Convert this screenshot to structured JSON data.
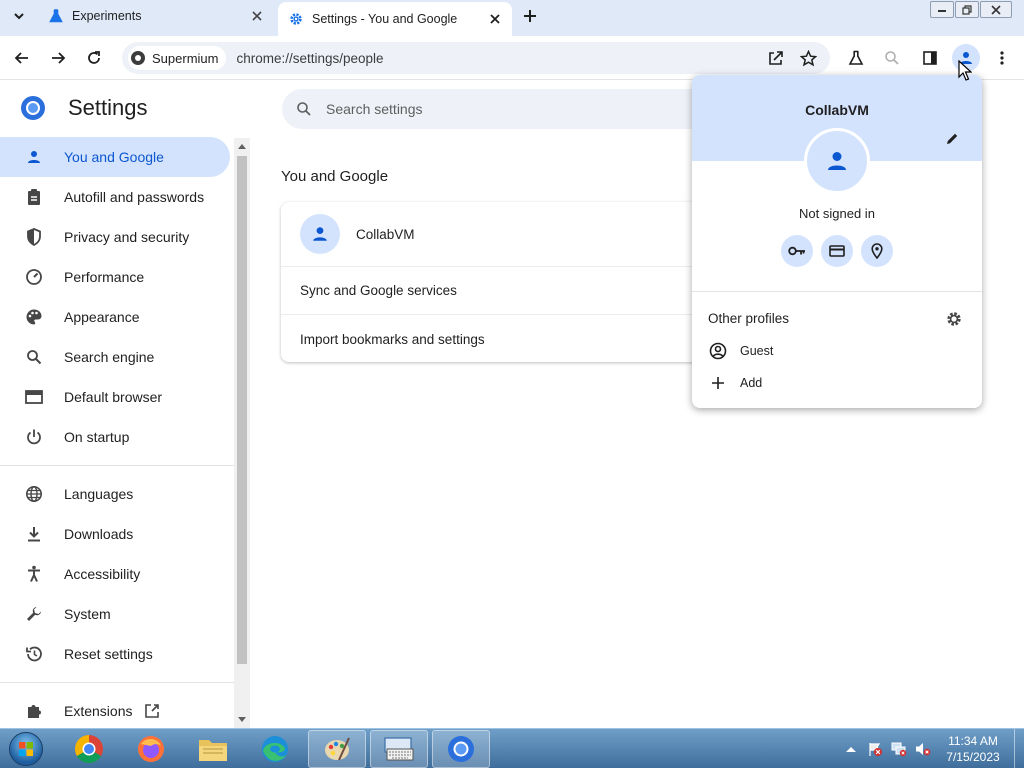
{
  "tabs": [
    {
      "title": "Experiments",
      "icon": "flask-icon"
    },
    {
      "title": "Settings - You and Google",
      "icon": "gear-icon"
    }
  ],
  "omnibox": {
    "site_chip": "Supermium",
    "url": "chrome://settings/people"
  },
  "sidebar": {
    "title": "Settings",
    "items": [
      {
        "label": "You and Google",
        "icon": "person-icon"
      },
      {
        "label": "Autofill and passwords",
        "icon": "clipboard-icon"
      },
      {
        "label": "Privacy and security",
        "icon": "shield-icon"
      },
      {
        "label": "Performance",
        "icon": "speedometer-icon"
      },
      {
        "label": "Appearance",
        "icon": "palette-icon"
      },
      {
        "label": "Search engine",
        "icon": "search-icon"
      },
      {
        "label": "Default browser",
        "icon": "browser-icon"
      },
      {
        "label": "On startup",
        "icon": "power-icon"
      },
      {
        "label": "Languages",
        "icon": "globe-icon"
      },
      {
        "label": "Downloads",
        "icon": "download-icon"
      },
      {
        "label": "Accessibility",
        "icon": "accessibility-icon"
      },
      {
        "label": "System",
        "icon": "wrench-icon"
      },
      {
        "label": "Reset settings",
        "icon": "history-icon"
      },
      {
        "label": "Extensions",
        "icon": "puzzle-icon"
      }
    ]
  },
  "main": {
    "search_placeholder": "Search settings",
    "section_title": "You and Google",
    "profile_name": "CollabVM",
    "rows": [
      "Sync and Google services",
      "Import bookmarks and settings"
    ]
  },
  "popup": {
    "name": "CollabVM",
    "status": "Not signed in",
    "other_profiles_title": "Other profiles",
    "items": [
      "Guest",
      "Add"
    ]
  },
  "taskbar": {
    "time": "11:34 AM",
    "date": "7/15/2023"
  },
  "colors": {
    "accent": "#0b57d0",
    "selection": "#d3e3fd",
    "tabstrip": "#dfe9f8"
  }
}
